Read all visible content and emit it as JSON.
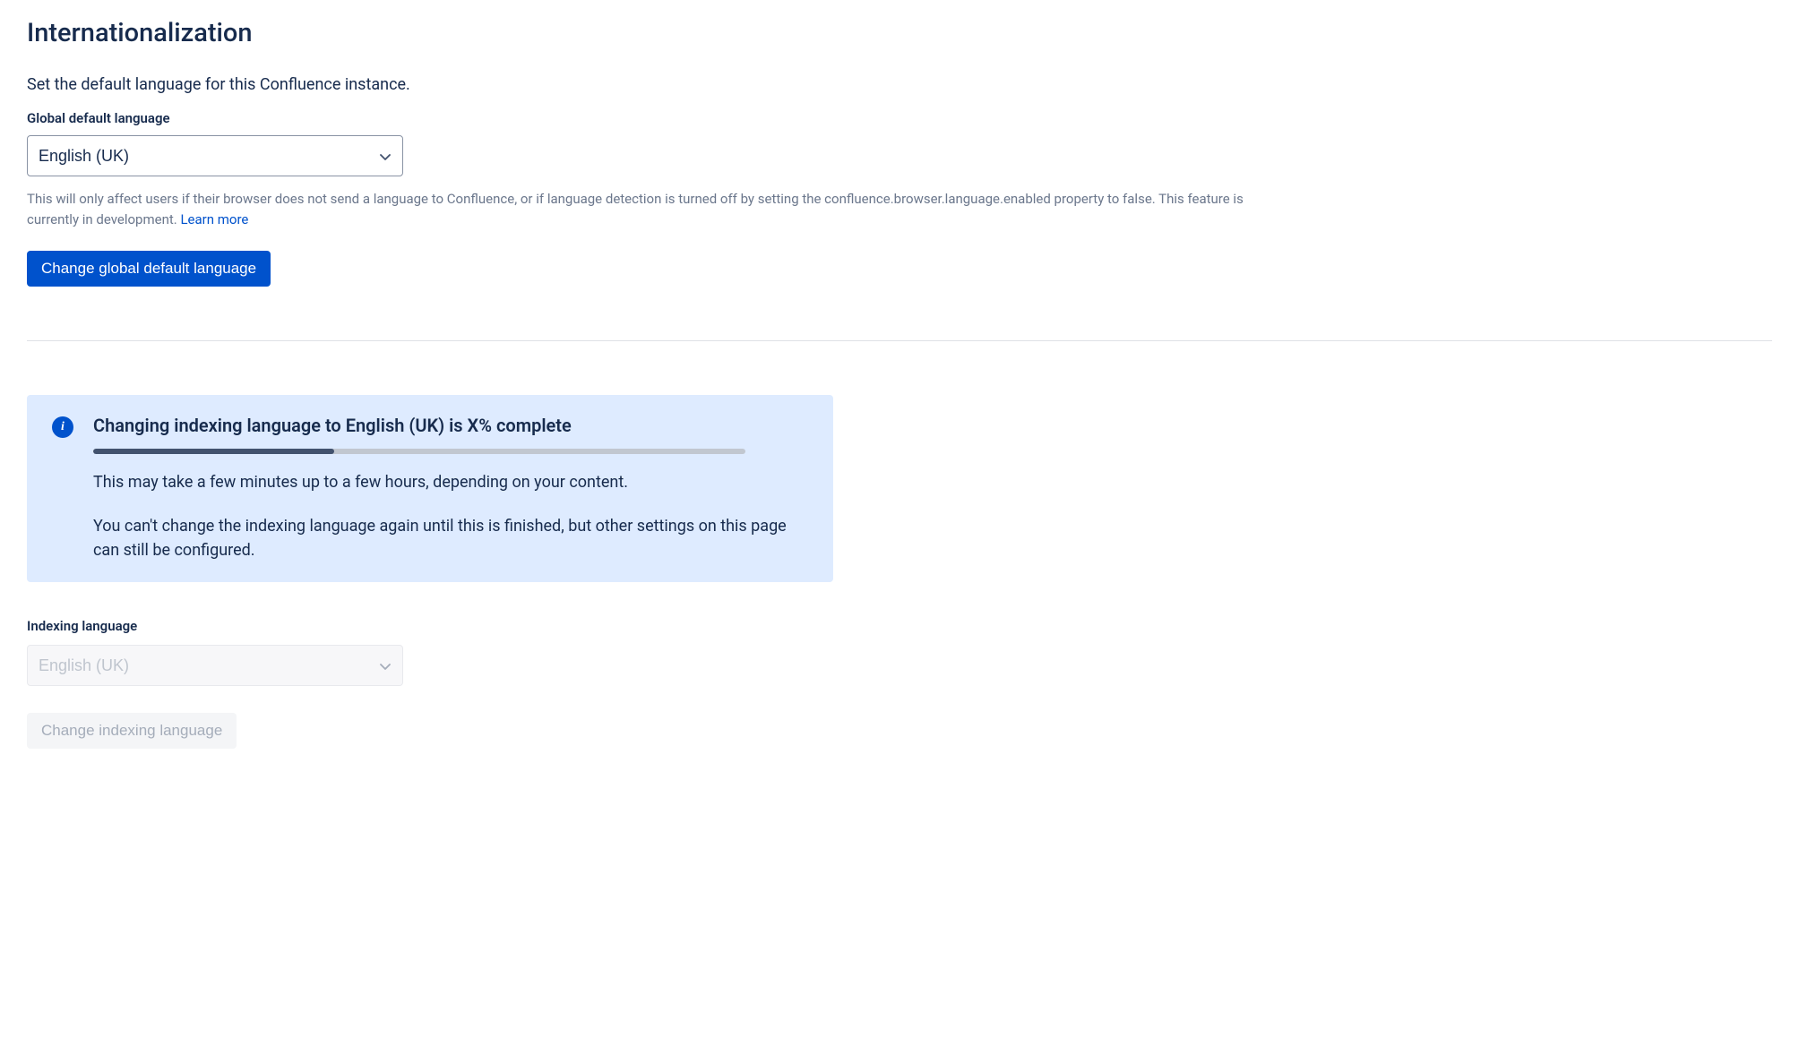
{
  "page": {
    "title": "Internationalization"
  },
  "globalLanguage": {
    "description": "Set the default language for this Confluence instance.",
    "label": "Global default language",
    "selectedValue": "English (UK)",
    "helpText": "This will only affect users if their browser does not send a language to Confluence, or if language detection is turned off by setting the confluence.browser.language.enabled property to false. This feature is currently in development. ",
    "learnMoreLabel": "Learn more",
    "buttonLabel": "Change global default language"
  },
  "infoPanel": {
    "title": "Changing indexing language to English (UK) is X% complete",
    "progressPercent": 37,
    "text1": "This may take a few minutes up to a few hours, depending on your content.",
    "text2": "You can't change the indexing language again until this is finished, but other settings on this page can still be configured."
  },
  "indexingLanguage": {
    "label": "Indexing language",
    "selectedValue": "English (UK)",
    "buttonLabel": "Change indexing language"
  }
}
